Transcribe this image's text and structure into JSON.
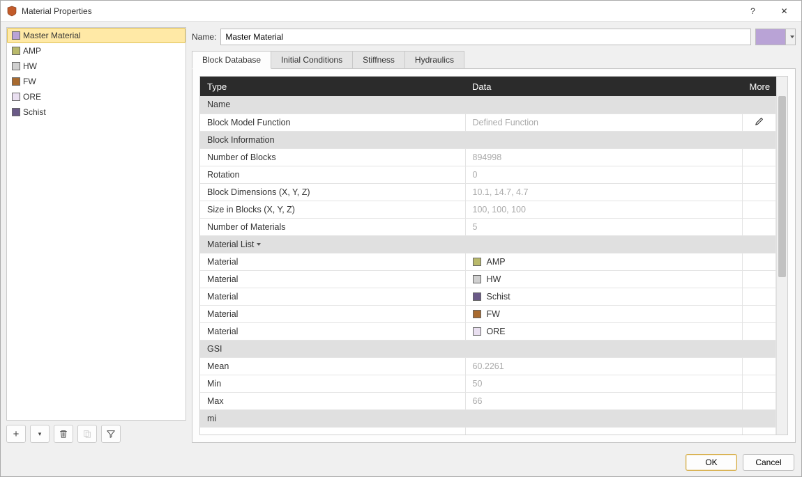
{
  "window": {
    "title": "Material Properties"
  },
  "sidebar": {
    "items": [
      {
        "label": "Master Material",
        "color": "#b9a3d6",
        "selected": true
      },
      {
        "label": "AMP",
        "color": "#b9b96a",
        "selected": false
      },
      {
        "label": "HW",
        "color": "#d0d0d0",
        "selected": false
      },
      {
        "label": "FW",
        "color": "#a86a2f",
        "selected": false
      },
      {
        "label": "ORE",
        "color": "#e9dff0",
        "selected": false
      },
      {
        "label": "Schist",
        "color": "#6a5a87",
        "selected": false
      }
    ]
  },
  "name_field": {
    "label": "Name:",
    "value": "Master Material",
    "color": "#b9a3d6"
  },
  "tabs": [
    {
      "label": "Block Database",
      "active": true
    },
    {
      "label": "Initial Conditions",
      "active": false
    },
    {
      "label": "Stiffness",
      "active": false
    },
    {
      "label": "Hydraulics",
      "active": false
    }
  ],
  "grid": {
    "headers": {
      "type": "Type",
      "data": "Data",
      "more": "More"
    },
    "rows": [
      {
        "kind": "section",
        "type": "Name"
      },
      {
        "kind": "row",
        "type": "Block Model Function",
        "data": "Defined Function",
        "muted": true,
        "more": "edit"
      },
      {
        "kind": "section",
        "type": "Block Information"
      },
      {
        "kind": "row",
        "type": "Number of Blocks",
        "data": "894998",
        "muted": true
      },
      {
        "kind": "row",
        "type": "Rotation",
        "data": "0",
        "muted": true
      },
      {
        "kind": "row",
        "type": "Block Dimensions (X, Y, Z)",
        "data": "10.1, 14.7, 4.7",
        "muted": true
      },
      {
        "kind": "row",
        "type": "Size in Blocks (X, Y, Z)",
        "data": "100, 100, 100",
        "muted": true
      },
      {
        "kind": "row",
        "type": "Number of Materials",
        "data": "5",
        "muted": true
      },
      {
        "kind": "section",
        "type": "Material List",
        "chev": true
      },
      {
        "kind": "mat",
        "type": "Material",
        "name": "AMP",
        "color": "#b9b96a"
      },
      {
        "kind": "mat",
        "type": "Material",
        "name": "HW",
        "color": "#d0d0d0"
      },
      {
        "kind": "mat",
        "type": "Material",
        "name": "Schist",
        "color": "#6a5a87"
      },
      {
        "kind": "mat",
        "type": "Material",
        "name": "FW",
        "color": "#a86a2f"
      },
      {
        "kind": "mat",
        "type": "Material",
        "name": "ORE",
        "color": "#e9dff0"
      },
      {
        "kind": "section",
        "type": "GSI"
      },
      {
        "kind": "row",
        "type": "Mean",
        "data": "60.2261",
        "muted": true
      },
      {
        "kind": "row",
        "type": "Min",
        "data": "50",
        "muted": true
      },
      {
        "kind": "row",
        "type": "Max",
        "data": "66",
        "muted": true
      },
      {
        "kind": "section",
        "type": "mi"
      },
      {
        "kind": "row",
        "type": "",
        "data": ""
      }
    ]
  },
  "footer": {
    "ok": "OK",
    "cancel": "Cancel"
  },
  "icons": {
    "help": "?",
    "close": "✕",
    "plus": "+",
    "dropdown": "▾"
  }
}
